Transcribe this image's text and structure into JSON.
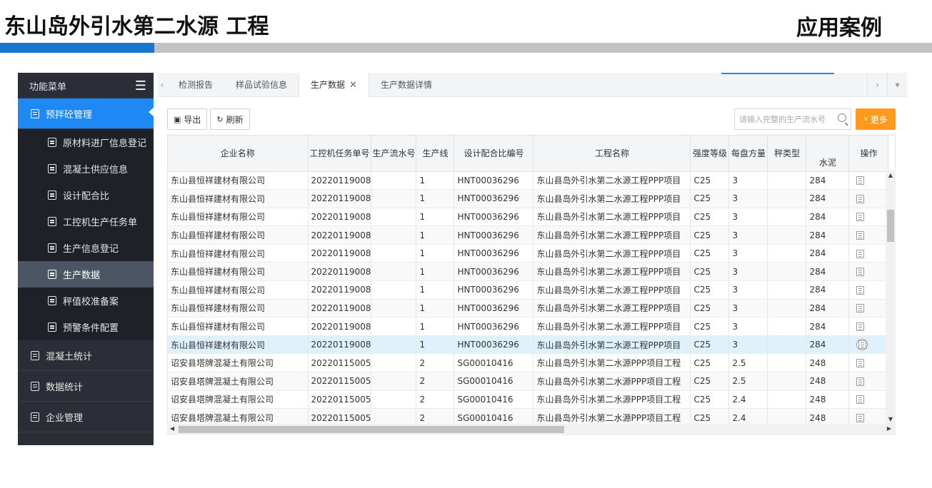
{
  "slide": {
    "title": "东山岛外引水第二水源 工程",
    "right_title": "应用案例"
  },
  "sidebar": {
    "header": "功能菜单",
    "active_group": "预拌砼管理",
    "sub_items": [
      {
        "label": "原材料进厂信息登记"
      },
      {
        "label": "混凝土供应信息"
      },
      {
        "label": "设计配合比"
      },
      {
        "label": "工控机生产任务单"
      },
      {
        "label": "生产信息登记"
      },
      {
        "label": "生产数据"
      },
      {
        "label": "秤值校准备案"
      },
      {
        "label": "预警条件配置"
      }
    ],
    "groups": [
      {
        "label": "混凝土统计"
      },
      {
        "label": "数据统计"
      },
      {
        "label": "企业管理"
      }
    ]
  },
  "tabs": [
    {
      "label": "检测报告"
    },
    {
      "label": "样品试验信息"
    },
    {
      "label": "生产数据",
      "close": "✕"
    },
    {
      "label": "生产数据详情"
    }
  ],
  "toolbar": {
    "export_label": "导出",
    "refresh_label": "刷新"
  },
  "search": {
    "placeholder": "请输入完整的生产流水号"
  },
  "more_label": "更多",
  "table": {
    "headers": [
      "企业名称",
      "工控机任务单号",
      "生产流水号",
      "生产线",
      "设计配合比编号",
      "工程名称",
      "强度等级",
      "每盘方量",
      "秤类型",
      "水泥",
      "操作"
    ],
    "rows": [
      [
        "东山县恒祥建材有限公司",
        "20220119008",
        "",
        "1",
        "HNT00036296",
        "东山县岛外引水第二水源工程PPP项目",
        "C25",
        "3",
        "",
        "284"
      ],
      [
        "东山县恒祥建材有限公司",
        "20220119008",
        "",
        "1",
        "HNT00036296",
        "东山县岛外引水第二水源工程PPP项目",
        "C25",
        "3",
        "",
        "284"
      ],
      [
        "东山县恒祥建材有限公司",
        "20220119008",
        "",
        "1",
        "HNT00036296",
        "东山县岛外引水第二水源工程PPP项目",
        "C25",
        "3",
        "",
        "284"
      ],
      [
        "东山县恒祥建材有限公司",
        "20220119008",
        "",
        "1",
        "HNT00036296",
        "东山县岛外引水第二水源工程PPP项目",
        "C25",
        "3",
        "",
        "284"
      ],
      [
        "东山县恒祥建材有限公司",
        "20220119008",
        "",
        "1",
        "HNT00036296",
        "东山县岛外引水第二水源工程PPP项目",
        "C25",
        "3",
        "",
        "284"
      ],
      [
        "东山县恒祥建材有限公司",
        "20220119008",
        "",
        "1",
        "HNT00036296",
        "东山县岛外引水第二水源工程PPP项目",
        "C25",
        "3",
        "",
        "284"
      ],
      [
        "东山县恒祥建材有限公司",
        "20220119008",
        "",
        "1",
        "HNT00036296",
        "东山县岛外引水第二水源工程PPP项目",
        "C25",
        "3",
        "",
        "284"
      ],
      [
        "东山县恒祥建材有限公司",
        "20220119008",
        "",
        "1",
        "HNT00036296",
        "东山县岛外引水第二水源工程PPP项目",
        "C25",
        "3",
        "",
        "284"
      ],
      [
        "东山县恒祥建材有限公司",
        "20220119008",
        "",
        "1",
        "HNT00036296",
        "东山县岛外引水第二水源工程PPP项目",
        "C25",
        "3",
        "",
        "284"
      ],
      [
        "东山县恒祥建材有限公司",
        "20220119008",
        "",
        "1",
        "HNT00036296",
        "东山县岛外引水第二水源工程PPP项目",
        "C25",
        "3",
        "",
        "284"
      ],
      [
        "诏安县塔牌混凝土有限公司",
        "20220115005",
        "",
        "2",
        "SG00010416",
        "东山县岛外引水第二水源PPP项目工程",
        "C25",
        "2.5",
        "",
        "248"
      ],
      [
        "诏安县塔牌混凝土有限公司",
        "20220115005",
        "",
        "2",
        "SG00010416",
        "东山县岛外引水第二水源PPP项目工程",
        "C25",
        "2.5",
        "",
        "248"
      ],
      [
        "诏安县塔牌混凝土有限公司",
        "20220115005",
        "",
        "2",
        "SG00010416",
        "东山县岛外引水第二水源PPP项目工程",
        "C25",
        "2.4",
        "",
        "248"
      ],
      [
        "诏安县塔牌混凝土有限公司",
        "20220115005",
        "",
        "2",
        "SG00010416",
        "东山县岛外引水第二水源PPP项目工程",
        "C25",
        "2.4",
        "",
        "248"
      ]
    ],
    "highlight_row": 9
  },
  "colors": {
    "accent_blue": "#1e88f5",
    "more_orange": "#ff9a1a",
    "sidebar_bg": "#2b2e36"
  }
}
